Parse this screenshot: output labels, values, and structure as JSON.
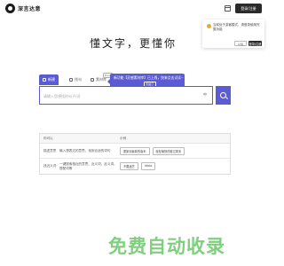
{
  "header": {
    "logo_text": "深言达意",
    "login_label": "登录/注册"
  },
  "popup": {
    "message": "当前处于游客模式，请登录使用完整功能",
    "cancel_label": "以后",
    "ok_label": "登录/注册"
  },
  "title": "懂文字，更懂你",
  "tabs": [
    {
      "label": "新建"
    },
    {
      "label": "找句"
    },
    {
      "label": "素材库"
    }
  ],
  "new_badge": "New",
  "tooltip": {
    "text": "新功能【灵感素材库】已上线，快来点击试试~",
    "button": "知道了"
  },
  "search": {
    "placeholder": "请输入您想找的句子/词",
    "language": "中"
  },
  "table": {
    "headers": [
      "你可以",
      "",
      "示例"
    ],
    "rows": [
      {
        "col1": "描述意思",
        "col2": "输入想表达的意思，找到合适的词句",
        "examples": [
          "更新到最新的版本",
          "轻松愉快的度过周末"
        ]
      },
      {
        "col1": "找近义词",
        "col2": "一键搜索相近的意思、近义词、反义词、搭配词等",
        "examples": [
          "不要迷茫",
          "idiolo"
        ]
      }
    ]
  },
  "banner_text": "免费自动收录",
  "colors": {
    "accent": "#5b5bd6",
    "banner_green": "#7fd07d",
    "dark_button": "#2a2a2a"
  }
}
